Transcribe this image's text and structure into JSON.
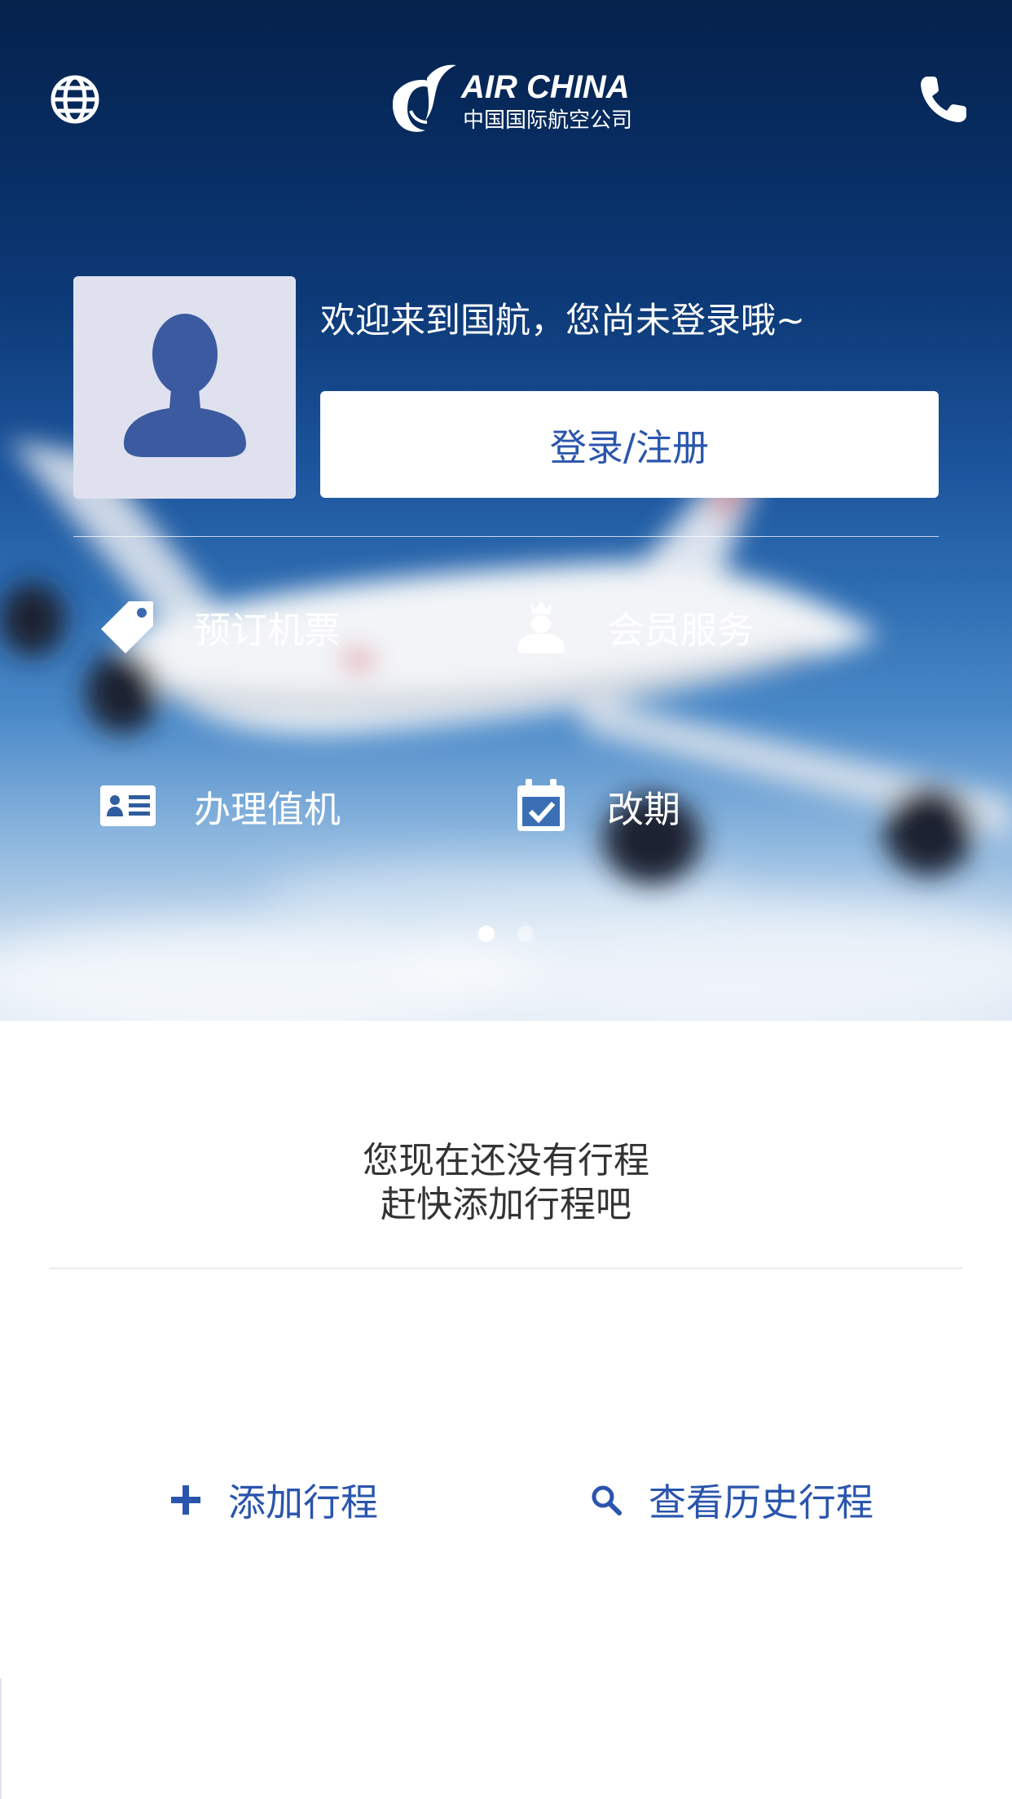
{
  "header": {
    "brand_name": "AIR CHINA",
    "brand_subtitle": "中国国际航空公司",
    "language_icon": "globe-icon",
    "contact_icon": "phone-icon"
  },
  "profile": {
    "welcome_text": "欢迎来到国航，您尚未登录哦~",
    "login_button": "登录/注册",
    "avatar_icon": "user-silhouette-icon"
  },
  "services": [
    {
      "label": "预订机票",
      "icon": "tag-icon"
    },
    {
      "label": "会员服务",
      "icon": "crowned-person-icon"
    },
    {
      "label": "办理值机",
      "icon": "id-card-icon"
    },
    {
      "label": "改期",
      "icon": "calendar-check-icon"
    }
  ],
  "pager": {
    "pages": 2,
    "active": 1
  },
  "trips": {
    "empty_line1": "您现在还没有行程",
    "empty_line2": "赶快添加行程吧",
    "add_trip": "添加行程",
    "history": "查看历史行程"
  },
  "colors": {
    "accent": "#2a55ad",
    "navy": "#05214c",
    "avatar_bg": "#dfe2ee",
    "avatar_fg": "#3b5aa0"
  }
}
